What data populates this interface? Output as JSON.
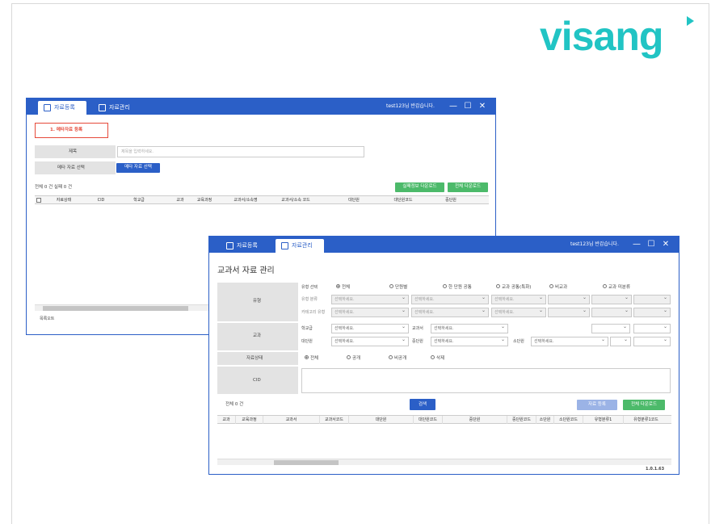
{
  "brand": {
    "logo_text": "visang",
    "color": "#21c4c4"
  },
  "back_window": {
    "tabs": [
      {
        "label": "자료등록",
        "icon": "edit-icon"
      },
      {
        "label": "자료관리",
        "icon": "document-icon"
      }
    ],
    "user_greeting": "test123님 반갑습니다.",
    "window_controls": [
      "—",
      "☐",
      "✕"
    ],
    "section_title": "1. 메타자료 등록",
    "form": {
      "title_label": "제목",
      "title_placeholder": "제목을 입력하세요.",
      "meta_label": "메타 자료 선택",
      "meta_button": "메타 자료 선택"
    },
    "counts": "전체 0 건   실패 0 건",
    "buttons": {
      "fail_download": "실패정보 다운로드",
      "all_download": "전체 다운로드"
    },
    "columns": [
      "",
      "자료상태",
      "CID",
      "학교급",
      "교과",
      "교육과정",
      "교과서/소속명",
      "교과서/소속 코드",
      "대단원",
      "대단원코드",
      "중단원",
      ""
    ],
    "footer_tab": "목록오트"
  },
  "front_window": {
    "tabs": [
      {
        "label": "자료등록",
        "icon": "edit-icon"
      },
      {
        "label": "자료관리",
        "icon": "document-icon"
      }
    ],
    "user_greeting": "test123님 반갑습니다.",
    "window_controls": [
      "—",
      "☐",
      "✕"
    ],
    "page_title": "교과서 자료 관리",
    "type_label": "유형",
    "type_select_label": "유형 선택",
    "type_options": [
      {
        "label": "전체",
        "checked": true
      },
      {
        "label": "단원별",
        "checked": false
      },
      {
        "label": "한 단원 공통",
        "checked": false
      },
      {
        "label": "교과 공통(특화)",
        "checked": false
      },
      {
        "label": "비교과",
        "checked": false
      },
      {
        "label": "교과 미분류",
        "checked": false
      }
    ],
    "type_cat_label": "유형 분류",
    "category_label": "카테고리 유형",
    "placeholder": "선택하세요.",
    "subject_label": "교과",
    "school_level": "학교급",
    "textbook": "교과서",
    "unit_large": "대단원",
    "unit_mid": "중단원",
    "unit_small": "소단원",
    "status_label": "자료상태",
    "status_options": [
      {
        "label": "전체",
        "checked": true
      },
      {
        "label": "공개",
        "checked": false
      },
      {
        "label": "비공개",
        "checked": false
      },
      {
        "label": "삭제",
        "checked": false
      }
    ],
    "cid_label": "CID",
    "count": "전체 0 건",
    "buttons": {
      "search": "검색",
      "register": "자료 등록",
      "download_all": "전체 다운로드"
    },
    "columns": [
      "교과",
      "교육과정",
      "교과서",
      "교과서코드",
      "대단원",
      "대단원코드",
      "중단원",
      "중단원코드",
      "소단원",
      "소단원코드",
      "유형분류1",
      "유형분류1코드"
    ],
    "version": "1.0.1.63"
  }
}
